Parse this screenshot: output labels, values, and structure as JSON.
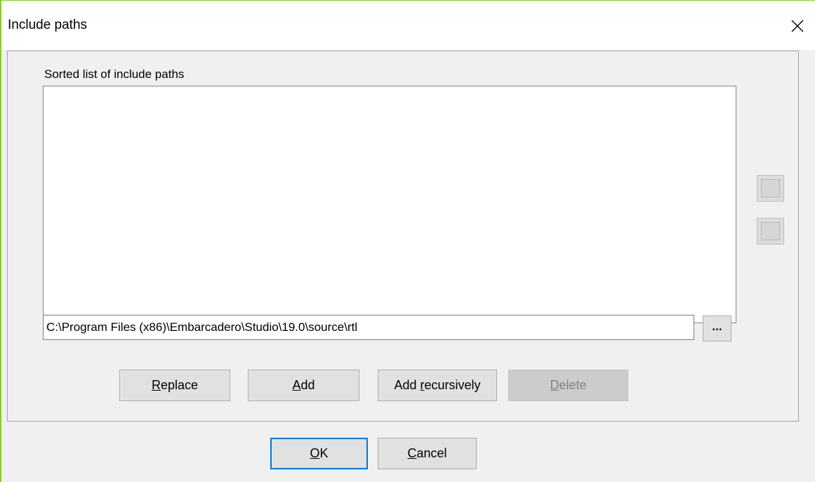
{
  "window": {
    "title": "Include paths",
    "close_glyph": "✕"
  },
  "group": {
    "label": "Sorted list of include paths"
  },
  "list": {
    "items": []
  },
  "path_field": {
    "value": "C:\\Program Files (x86)\\Embarcadero\\Studio\\19.0\\source\\rtl"
  },
  "browse_button": {
    "label": "..."
  },
  "actions": {
    "replace": {
      "mnemonic": "R",
      "rest": "eplace",
      "enabled": true
    },
    "add": {
      "mnemonic": "A",
      "rest": "dd",
      "enabled": true
    },
    "add_recursively": {
      "prefix": "Add ",
      "mnemonic": "r",
      "rest": "ecursively",
      "enabled": true
    },
    "delete": {
      "mnemonic": "D",
      "rest": "elete",
      "enabled": false
    }
  },
  "footer": {
    "ok": {
      "mnemonic": "O",
      "rest": "K"
    },
    "cancel": {
      "mnemonic": "C",
      "rest": "ancel"
    }
  },
  "colors": {
    "accent": "#8cc63e",
    "focus_border": "#0078d7",
    "dialog_bg": "#f0f0f0"
  },
  "icons": {
    "close": "close-icon",
    "move_up": "move-up-icon",
    "move_down": "move-down-icon"
  }
}
